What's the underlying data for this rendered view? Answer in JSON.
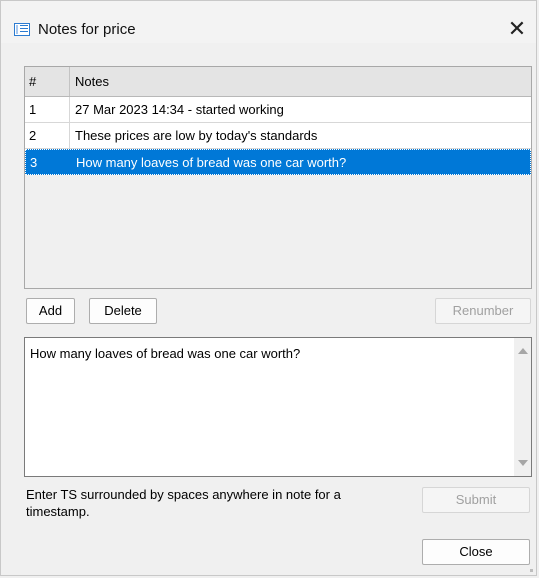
{
  "window": {
    "title": "Notes for price",
    "close_glyph": "✕",
    "icon": "window-list-icon"
  },
  "grid": {
    "columns": [
      "#",
      "Notes"
    ],
    "rows": [
      {
        "num": "1",
        "note": "27 Mar 2023 14:34 - started working"
      },
      {
        "num": "2",
        "note": "These prices are low by today's standards"
      },
      {
        "num": "3",
        "note": "How many loaves of bread was one car worth?"
      }
    ],
    "selected_index": 2
  },
  "buttons": {
    "add": "Add",
    "delete": "Delete",
    "renumber": "Renumber",
    "submit": "Submit",
    "close": "Close"
  },
  "editor": {
    "value": "How many loaves of bread was one car worth?"
  },
  "hint": "Enter TS surrounded by spaces anywhere in note for a timestamp.",
  "colors": {
    "selection": "#0078d7",
    "window_bg": "#f0f0f0"
  }
}
